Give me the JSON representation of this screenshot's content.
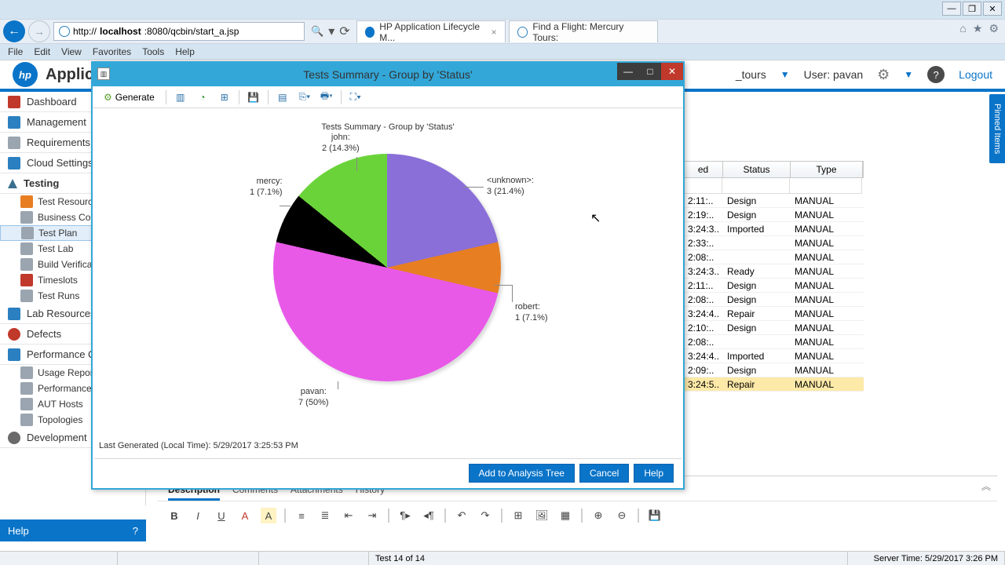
{
  "browser": {
    "url_prefix": "http://",
    "url_host": "localhost",
    "url_rest": ":8080/qcbin/start_a.jsp",
    "tab1": "HP Application Lifecycle M...",
    "tab2": "Find a Flight: Mercury Tours:"
  },
  "menus": [
    "File",
    "Edit",
    "View",
    "Favorites",
    "Tools",
    "Help"
  ],
  "app": {
    "title_short": "Applic",
    "project_suffix": "_tours",
    "user_label": "User: pavan",
    "logout": "Logout",
    "pinned": "Pinned Items"
  },
  "sidebar": {
    "cats": [
      {
        "label": "Dashboard"
      },
      {
        "label": "Management"
      },
      {
        "label": "Requirements"
      },
      {
        "label": "Cloud Settings"
      },
      {
        "label": "Testing"
      },
      {
        "label": "Lab Resources"
      },
      {
        "label": "Defects"
      },
      {
        "label": "Performance C"
      },
      {
        "label": "Development"
      }
    ],
    "testing_subs": [
      "Test Resource",
      "Business Com",
      "Test Plan",
      "Test Lab",
      "Build Verificatio",
      "Timeslots",
      "Test Runs"
    ],
    "perf_subs": [
      "Usage Report",
      "Performance",
      "AUT Hosts",
      "Topologies"
    ]
  },
  "help_bar": {
    "label": "Help",
    "q": "?"
  },
  "table": {
    "headers": {
      "c1": "ed",
      "c2": "Status",
      "c3": "Type"
    },
    "rows": [
      {
        "c1": "2:11:..",
        "c2": "Design",
        "c3": "MANUAL"
      },
      {
        "c1": "2:19:..",
        "c2": "Design",
        "c3": "MANUAL"
      },
      {
        "c1": "3:24:3..",
        "c2": "Imported",
        "c3": "MANUAL"
      },
      {
        "c1": "2:33:..",
        "c2": "",
        "c3": "MANUAL"
      },
      {
        "c1": "2:08:..",
        "c2": "",
        "c3": "MANUAL"
      },
      {
        "c1": "3:24:3..",
        "c2": "Ready",
        "c3": "MANUAL"
      },
      {
        "c1": "2:11:..",
        "c2": "Design",
        "c3": "MANUAL"
      },
      {
        "c1": "2:08:..",
        "c2": "Design",
        "c3": "MANUAL"
      },
      {
        "c1": "3:24:4..",
        "c2": "Repair",
        "c3": "MANUAL"
      },
      {
        "c1": "2:10:..",
        "c2": "Design",
        "c3": "MANUAL"
      },
      {
        "c1": "2:08:..",
        "c2": "",
        "c3": "MANUAL"
      },
      {
        "c1": "3:24:4..",
        "c2": "Imported",
        "c3": "MANUAL"
      },
      {
        "c1": "2:09:..",
        "c2": "Design",
        "c3": "MANUAL"
      },
      {
        "c1": "3:24:5..",
        "c2": "Repair",
        "c3": "MANUAL",
        "hl": true
      }
    ]
  },
  "desc": {
    "tabs": [
      "Description",
      "Comments",
      "Attachments",
      "History"
    ]
  },
  "status": {
    "record": "Test 14 of 14",
    "server": "Server Time: 5/29/2017 3:26 PM"
  },
  "dialog": {
    "title": "Tests Summary - Group by 'Status'",
    "generate": "Generate",
    "last_generated": "Last Generated (Local Time): 5/29/2017 3:25:53 PM",
    "buttons": {
      "add": "Add to Analysis Tree",
      "cancel": "Cancel",
      "help": "Help"
    }
  },
  "chart_data": {
    "type": "pie",
    "title": "Tests Summary - Group by 'Status'",
    "categories": [
      "<unknown>",
      "robert",
      "pavan",
      "mercy",
      "john"
    ],
    "values": [
      3,
      1,
      7,
      1,
      2
    ],
    "percentages": [
      21.4,
      7.1,
      50.0,
      7.1,
      14.3
    ],
    "colors": [
      "#8a6fd8",
      "#e77e22",
      "#e859e8",
      "#000000",
      "#6bd33a"
    ],
    "labels": {
      "unknown": "<unknown>:\n3 (21.4%)",
      "robert": "robert:\n1 (7.1%)",
      "pavan": "pavan:\n7 (50%)",
      "mercy": "mercy:\n1 (7.1%)",
      "john": "john:\n2 (14.3%)"
    }
  }
}
